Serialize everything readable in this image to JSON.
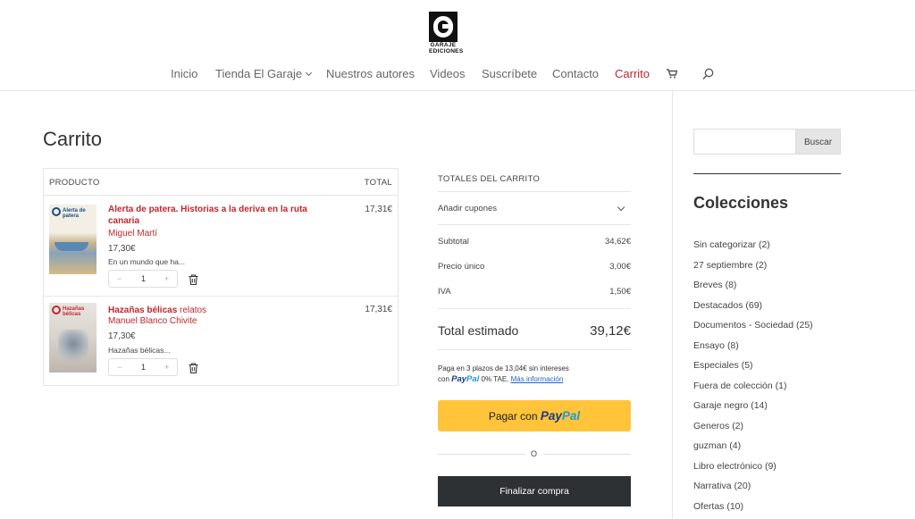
{
  "header": {
    "logo_text_line1": "GARAJE",
    "logo_text_line2": "EDICIONES",
    "nav": [
      {
        "label": "Inicio"
      },
      {
        "label": "Tienda El Garaje"
      },
      {
        "label": "Nuestros autores"
      },
      {
        "label": "Videos"
      },
      {
        "label": "Suscríbete"
      },
      {
        "label": "Contacto"
      },
      {
        "label": "Carrito"
      }
    ],
    "cart_icon": "cart-icon",
    "search_icon": "search-icon"
  },
  "page": {
    "title": "Carrito"
  },
  "cart": {
    "col_product": "PRODUCTO",
    "col_total": "TOTAL",
    "items": [
      {
        "name": "Alerta de patera. Historias a la deriva en la ruta canaria",
        "name_suffix": "",
        "author": "Miguel Martí",
        "price": "17,30€",
        "desc": "En un mundo que ha...",
        "qty": "1",
        "total": "17,31€",
        "thumb_title": "Alerta de patera"
      },
      {
        "name": "Hazañas bélicas",
        "name_suffix": " relatos",
        "author": "Manuel Blanco Chivite",
        "price": "17,30€",
        "desc": "Hazañas bélicas...",
        "qty": "1",
        "total": "17,31€",
        "thumb_title": "Hazañas bélicas"
      }
    ],
    "qty_minus": "−",
    "qty_plus": "+"
  },
  "totals": {
    "heading": "TOTALES DEL CARRITO",
    "coupon_label": "Añadir cupones",
    "subtotal_label": "Subtotal",
    "subtotal_value": "34,62€",
    "flat_label": "Precio único",
    "flat_value": "3,00€",
    "tax_label": "IVA",
    "tax_value": "1,50€",
    "grand_label": "Total estimado",
    "grand_value": "39,12€",
    "paypal_note_1": "Paga en 3 plazos de 13,04€ sin intereses",
    "paypal_note_con": "con",
    "paypal_note_tae": "0% TAE.",
    "paypal_more": "Más información",
    "paypal_word_1": "Pay",
    "paypal_word_2": "Pal",
    "pay_button_prefix": "Pagar con",
    "or_text": "O",
    "checkout_label": "Finalizar compra"
  },
  "sidebar": {
    "search_button": "Buscar",
    "search_value": "",
    "title": "Colecciones",
    "categories": [
      "Sin categorizar (2)",
      "27 septiembre (2)",
      "Breves (8)",
      "Destacados (69)",
      "Documentos - Sociedad (25)",
      "Ensayo (8)",
      "Especiales (5)",
      "Fuera de colección (1)",
      "Garaje negro (14)",
      "Generos (2)",
      "guzman (4)",
      "Libro electrónico (9)",
      "Narrativa (20)",
      "Ofertas (10)"
    ]
  },
  "colors": {
    "accent_red": "#c0272d",
    "paypal_yellow": "#ffc439",
    "checkout_dark": "#2e3134"
  }
}
